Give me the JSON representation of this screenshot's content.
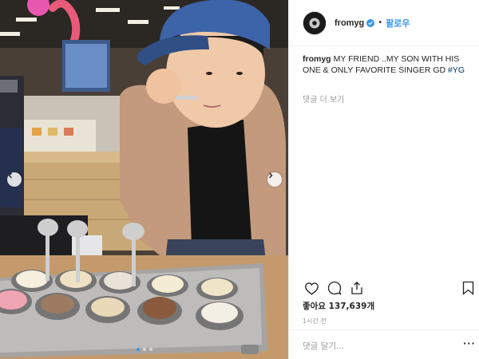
{
  "post": {
    "username": "fromyg",
    "separator": "•",
    "follow_label": "팔로우",
    "caption_text": "MY FRIEND ..MY SON WITH HIS ONE & ONLY FAVORITE SINGER GD ",
    "hashtag": "#YG",
    "view_comments": "댓글 더 보기",
    "likes_text": "좋아요 137,639개",
    "time_ago": "1시간 전",
    "comment_placeholder": "댓글 달기...",
    "more_options": "···",
    "carousel": {
      "slides": 3,
      "current_slide": 1
    }
  },
  "icons": {
    "avatar": "avatar-circle",
    "verified": "verified-badge-icon",
    "like": "heart-icon",
    "comment": "comment-bubble-icon",
    "share": "share-icon",
    "save": "bookmark-icon",
    "prev": "chevron-left-icon",
    "next": "chevron-right-icon"
  },
  "colors": {
    "link_blue": "#3897f0",
    "hashtag": "#003569",
    "muted": "#999999",
    "text": "#262626",
    "border": "#efefef"
  }
}
